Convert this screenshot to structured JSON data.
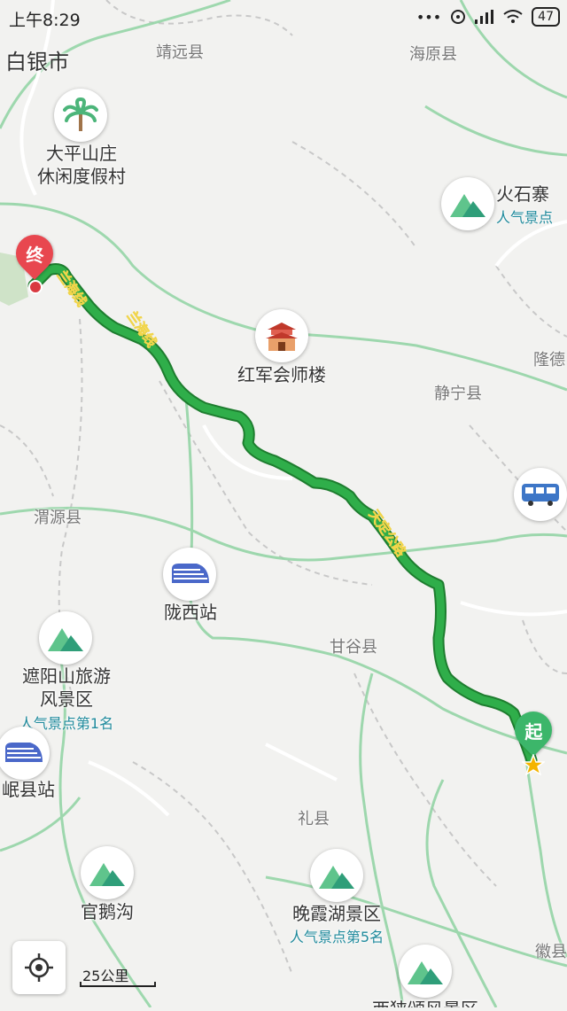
{
  "status_bar": {
    "time": "上午8:29",
    "signal_dots": "•••",
    "battery": "47"
  },
  "cities": {
    "baiyin": "白银市"
  },
  "counties": {
    "jingyuan": "靖远县",
    "haiyuan": "海原县",
    "longde": "隆德",
    "jingning": "静宁县",
    "weiyuan": "渭源县",
    "gangu": "甘谷县",
    "lixian": "礼县",
    "hui": "徽县"
  },
  "pois": {
    "dapingshan": {
      "line1": "大平山庄",
      "line2": "休闲度假村",
      "icon": "palm-tree-icon"
    },
    "huoshizhai": {
      "name": "火石寨",
      "sub": "人气景点",
      "icon": "mountain-icon"
    },
    "hongjun": {
      "name": "红军会师楼",
      "icon": "gate-tower-icon"
    },
    "bus": {
      "icon": "bus-icon"
    },
    "longxi": {
      "name": "陇西站",
      "icon": "train-icon"
    },
    "zheyangshan": {
      "line1": "遮阳山旅游",
      "line2": "风景区",
      "sub": "人气景点第1名",
      "icon": "mountain-icon"
    },
    "minxian": {
      "name": "岷县站",
      "icon": "train-icon"
    },
    "guanegou": {
      "name": "官鹅沟",
      "icon": "mountain-icon"
    },
    "wanxiahu": {
      "name": "晚霞湖景区",
      "sub": "人气景点第5名",
      "icon": "mountain-icon"
    },
    "xixia": {
      "name": "西狭颂风景区",
      "icon": "mountain-icon"
    }
  },
  "route": {
    "color": "#2fae4a",
    "road_labels": {
      "a": "兰海线",
      "b": "兰海线",
      "c": "天定公路"
    },
    "end_label": "终",
    "start_label": "起",
    "end_color": "#e8474f",
    "start_color": "#3cb66a"
  },
  "controls": {
    "locate_icon": "locate-crosshair-icon",
    "scale_label": "25公里"
  }
}
